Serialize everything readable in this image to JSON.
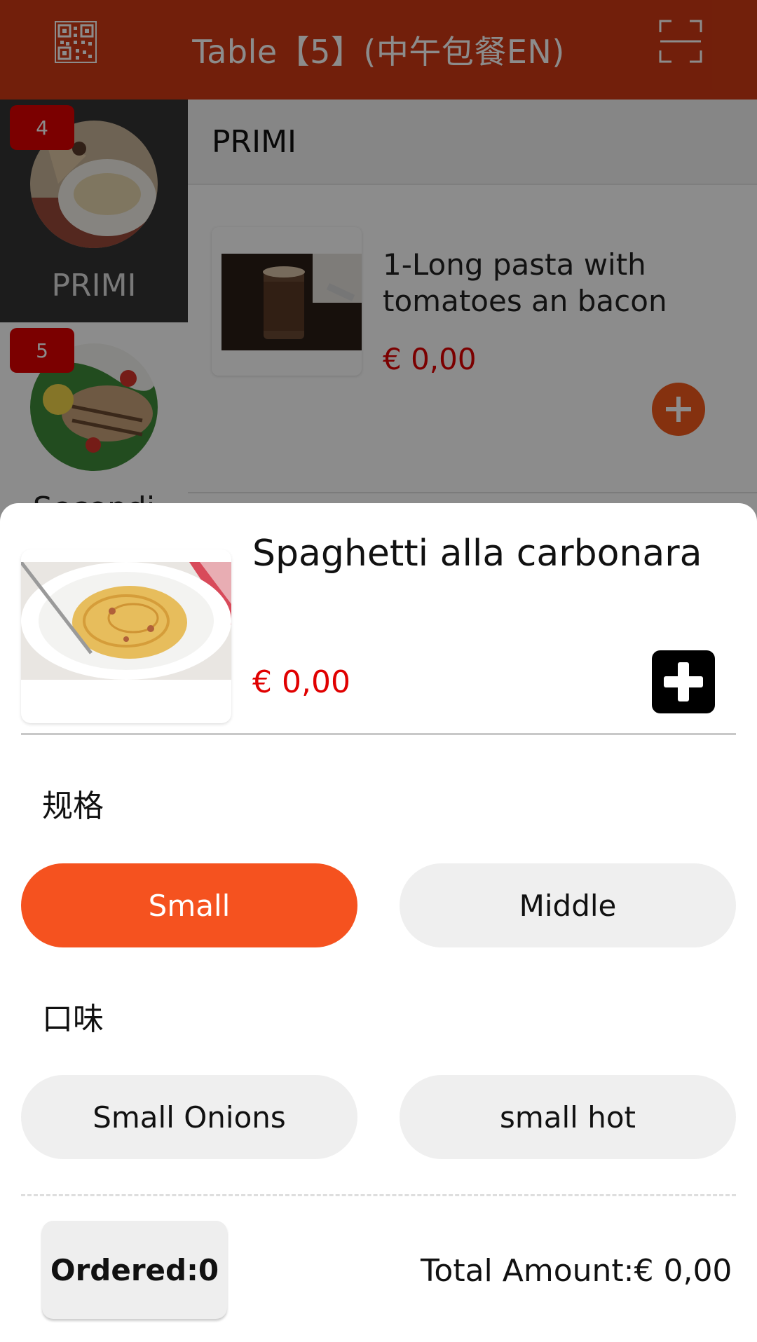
{
  "header": {
    "title": "Table【5】(中午包餐EN)",
    "left_icon": "qr-code-icon",
    "right_icon": "scan-icon",
    "color": "#d03a14"
  },
  "sidebar": {
    "items": [
      {
        "label": "PRIMI",
        "badge": "4",
        "active": true
      },
      {
        "label": "Secondi",
        "badge": "5",
        "active": false
      }
    ]
  },
  "content": {
    "section_title": "PRIMI",
    "items": [
      {
        "name": "1-Long pasta with tomatoes an bacon",
        "price": "€ 0,00"
      }
    ]
  },
  "sheet": {
    "dish_name": "Spaghetti alla carbonara",
    "price": "€ 0,00",
    "groups": [
      {
        "label": "规格",
        "options": [
          {
            "label": "Small",
            "selected": true
          },
          {
            "label": "Middle",
            "selected": false
          }
        ]
      },
      {
        "label": "口味",
        "options": [
          {
            "label": "Small Onions",
            "selected": false
          },
          {
            "label": "small hot",
            "selected": false
          }
        ]
      }
    ],
    "ordered_label": "Ordered:0",
    "total_label": "Total Amount:€ 0,00"
  },
  "colors": {
    "accent": "#f5521f",
    "price": "#e00000"
  }
}
